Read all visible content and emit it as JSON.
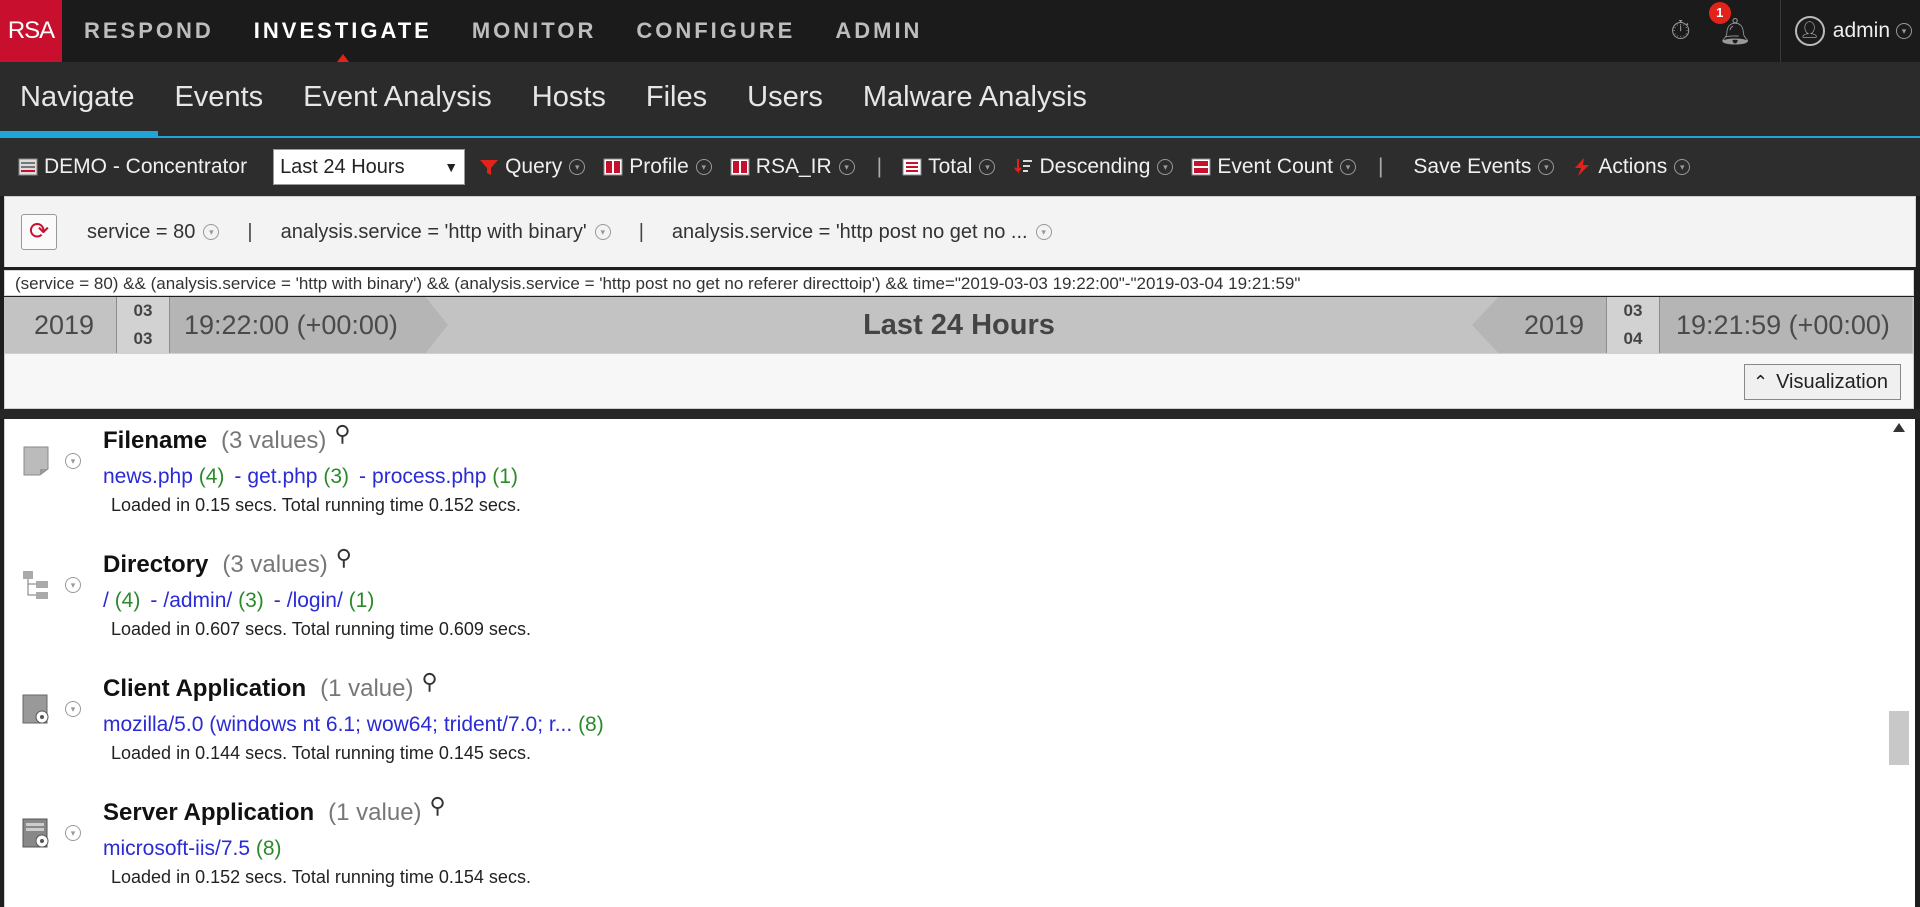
{
  "brand": {
    "logo_text": "RSA"
  },
  "top_nav": [
    {
      "label": "RESPOND",
      "active": false
    },
    {
      "label": "INVESTIGATE",
      "active": true
    },
    {
      "label": "MONITOR",
      "active": false
    },
    {
      "label": "CONFIGURE",
      "active": false
    },
    {
      "label": "ADMIN",
      "active": false
    }
  ],
  "top_right": {
    "notification_count": "1",
    "username": "admin"
  },
  "sub_nav": [
    {
      "label": "Navigate",
      "active": true
    },
    {
      "label": "Events",
      "active": false
    },
    {
      "label": "Event Analysis",
      "active": false
    },
    {
      "label": "Hosts",
      "active": false
    },
    {
      "label": "Files",
      "active": false
    },
    {
      "label": "Users",
      "active": false
    },
    {
      "label": "Malware Analysis",
      "active": false
    }
  ],
  "toolbar": {
    "source": "DEMO - Concentrator",
    "time_select": "Last 24 Hours",
    "query": "Query",
    "profile": "Profile",
    "rsa_ir": "RSA_IR",
    "total": "Total",
    "descending": "Descending",
    "event_count": "Event Count",
    "save_events": "Save Events",
    "actions": "Actions"
  },
  "breadcrumbs": [
    "service = 80",
    "analysis.service = 'http with binary'",
    "analysis.service = 'http post no get no ..."
  ],
  "query_string": "(service = 80) && (analysis.service = 'http with binary') && (analysis.service = 'http post no get no referer directtoip') && time=\"2019-03-03 19:22:00\"-\"2019-03-04 19:21:59\"",
  "time_range": {
    "start_year": "2019",
    "start_month": "03",
    "start_day": "03",
    "start_time": "19:22:00 (+00:00)",
    "label": "Last 24 Hours",
    "end_year": "2019",
    "end_month": "03",
    "end_day": "04",
    "end_time": "19:21:59 (+00:00)"
  },
  "visualization_button": "Visualization",
  "meta_groups": [
    {
      "title": "Filename",
      "count": "(3 values)",
      "icon": "file-icon",
      "values": [
        {
          "v": "news.php",
          "c": "(4)"
        },
        {
          "v": "get.php",
          "c": "(3)"
        },
        {
          "v": "process.php",
          "c": "(1)"
        }
      ],
      "timing": "Loaded in 0.15 secs. Total running time 0.152 secs."
    },
    {
      "title": "Directory",
      "count": "(3 values)",
      "icon": "directory-tree-icon",
      "values": [
        {
          "v": "/",
          "c": "(4)"
        },
        {
          "v": "/admin/",
          "c": "(3)"
        },
        {
          "v": "/login/",
          "c": "(1)"
        }
      ],
      "timing": "Loaded in 0.607 secs. Total running time 0.609 secs."
    },
    {
      "title": "Client Application",
      "count": "(1 value)",
      "icon": "client-app-icon",
      "values": [
        {
          "v": "mozilla/5.0 (windows nt 6.1; wow64; trident/7.0; r...",
          "c": "(8)"
        }
      ],
      "timing": "Loaded in 0.144 secs. Total running time 0.145 secs."
    },
    {
      "title": "Server Application",
      "count": "(1 value)",
      "icon": "server-app-icon",
      "values": [
        {
          "v": "microsoft-iis/7.5",
          "c": "(8)"
        }
      ],
      "timing": "Loaded in 0.152 secs. Total running time 0.154 secs."
    }
  ],
  "colors": {
    "brand_red": "#c8102e",
    "accent_blue": "#1fa5d8",
    "link_blue": "#2a2ad6",
    "count_green": "#2a8a2a"
  }
}
